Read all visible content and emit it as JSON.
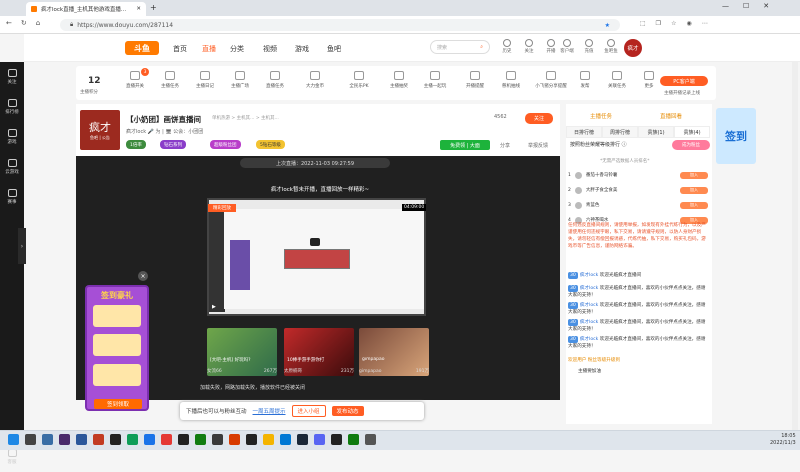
{
  "browser": {
    "tab_title": "疯才lock直播_主机其他游戏直播...",
    "url": "https://www.douyu.com/287114"
  },
  "header": {
    "logo": "斗鱼",
    "nav": [
      "首页",
      "直播",
      "分类",
      "视频",
      "游戏",
      "鱼吧"
    ],
    "search_placeholder": "搜索",
    "icons": [
      "历史",
      "关注",
      "开播",
      "客户端",
      "充值",
      "鱼吧鱼"
    ],
    "user": "疯才"
  },
  "sidebar": [
    "关注",
    "排行榜",
    "游戏",
    "云游戏",
    "赛事",
    "客服"
  ],
  "toolbar": {
    "level": "12",
    "level_label": "主播积分",
    "badge": "3",
    "items": [
      "直播开关",
      "主播任务",
      "主播日记",
      "主播广场",
      "直播任务",
      "大力金币",
      "全民乐PK",
      "主播抽奖",
      "主播一起玩",
      "开播提醒",
      "慈机抽线",
      "小飞猪分享提醒",
      "发帮",
      "关联任务",
      "更多"
    ],
    "pc_button": "PC客户端",
    "pc_sub": "主播开播记录上线"
  },
  "streamer": {
    "avatar_text": "疯才",
    "avatar_sub": "鱼吧 | 公告",
    "title": "【小奶团】画饼直播间",
    "subtitle": "疯才lock 🎤 为 | 🖥 公会：小团团",
    "breadcrumb": "单机热游 > 主机其... > 主机其...",
    "tags": [
      "1倍率",
      "钻石系列",
      "超级粉丝团",
      "5钻石等级"
    ],
    "follow_count": "4562",
    "follow_label": "关注",
    "gift_btn": "免费领 | 大面",
    "share": "分享",
    "report": "举报反馈"
  },
  "player": {
    "last_live": "上次直播：2022-11-03 09:27:59",
    "offline_text": "疯才lock暂未开播，直播回放一样精彩~",
    "badge": "精彩回放",
    "duration": "04:09:00",
    "load_fail": "加载失败，网路加载失败，播放软件已经被关闭",
    "thumbs": [
      {
        "name": "[大吧-主机] 好玩吗?",
        "views": "267万"
      },
      {
        "name": "10棒手游手游你打",
        "views": "231万"
      },
      {
        "name": "gimpapao",
        "views": "191万"
      }
    ],
    "thumb_authors": [
      "女流66",
      "太原楠哥",
      "gimpapao"
    ]
  },
  "signin": {
    "title": "签到豪礼",
    "button": "签到领取",
    "close": "×"
  },
  "popup": {
    "text": "下播后也可以与粉丝互动",
    "link": "一周五周提示",
    "b1": "进入小组",
    "b2": "发布动态"
  },
  "right": {
    "tabs": [
      "主播任务",
      "直播回看"
    ],
    "subtabs": [
      "日排行榜",
      "周排行榜",
      "贵族(1)",
      "贵族(4)"
    ],
    "rank_title": "按照粉丝荣耀等级排行 ⓘ",
    "fans_btn": "成为粉丝",
    "rank_hint": "*无需严选数据人员排名*",
    "ranks": [
      {
        "n": "1",
        "name": "番茄十香马铃薯",
        "b": "加入"
      },
      {
        "n": "2",
        "name": "大胖子食全食美",
        "b": "加入"
      },
      {
        "n": "3",
        "name": "青蓝色",
        "b": "加入"
      },
      {
        "n": "4",
        "name": "六神茶喝水",
        "b": "加入"
      }
    ],
    "rules": "任何违反直播间规则，请使用举报，如发现有外挂代练行为，以及严谨使用任何违规字眼，私下交易，请请遵守规则，以防人身财产损失，请勿轻信有偿回报诱惑，代练代抽，私下交易，购买礼包码，游戏币等广告信息，谨防网络诈骗。",
    "messages": [
      {
        "lv": "30",
        "name": "疯才lock",
        "text": "欢迎光临疯才直播间"
      },
      {
        "lv": "30",
        "name": "疯才lock",
        "text": "欢迎光临疯才直播间，喜欢的小伙伴点点关注，感谢大家的支持！"
      },
      {
        "lv": "30",
        "name": "疯才lock",
        "text": "欢迎光临疯才直播间，喜欢的小伙伴点点关注，感谢大家的支持！"
      },
      {
        "lv": "30",
        "name": "疯才lock",
        "text": "欢迎光临疯才直播间，喜欢的小伙伴点点关注，感谢大家的支持！"
      },
      {
        "lv": "30",
        "name": "疯才lock",
        "text": "欢迎光临疯才直播间，喜欢的小伙伴点点关注，感谢大家的支持！"
      }
    ],
    "sys_msg": "欢迎用户 粉丝等级升级到",
    "sys_msg2": "主播要加油",
    "ad": "签到"
  },
  "taskbar": {
    "time": "18:05",
    "date": "2022/11/3"
  },
  "colors": {
    "accent": "#ff5d23",
    "dark": "#1a1a1a",
    "purple": "#a64fd6"
  }
}
